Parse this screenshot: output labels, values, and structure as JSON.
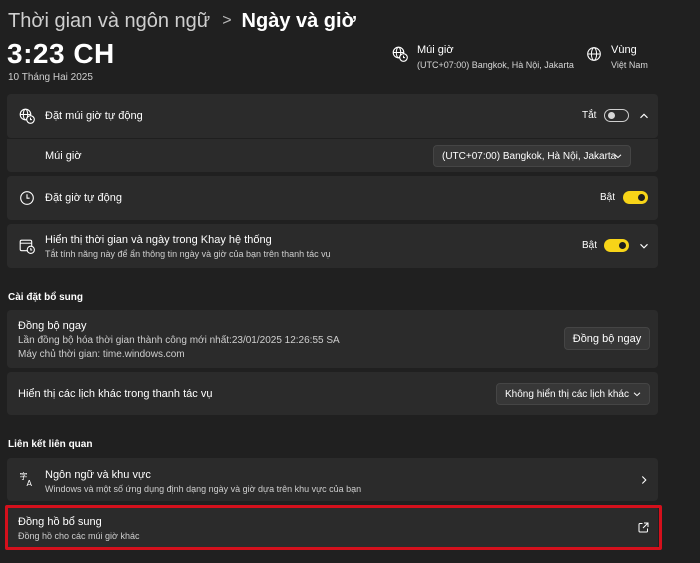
{
  "header": {
    "breadcrumb_parent": "Thời gian và ngôn ngữ",
    "breadcrumb_separator": ">",
    "breadcrumb_current": "Ngày và giờ"
  },
  "clock": {
    "time": "3:23 CH",
    "date": "10 Tháng Hai 2025"
  },
  "timezone_info": {
    "title": "Múi giờ",
    "value": "(UTC+07:00) Bangkok, Hà Nội, Jakarta",
    "icon": "globe-clock-icon"
  },
  "region_info": {
    "title": "Vùng",
    "value": "Việt Nam",
    "icon": "globe-icon"
  },
  "settings": {
    "auto_timezone": {
      "label": "Đặt múi giờ tự động",
      "state": "Tắt",
      "on": false,
      "icon": "timezone-icon"
    },
    "timezone_select": {
      "label": "Múi giờ",
      "value": "(UTC+07:00) Bangkok, Hà Nội, Jakarta"
    },
    "auto_time": {
      "label": "Đặt giờ tự động",
      "state": "Bật",
      "on": true,
      "icon": "clock-icon"
    },
    "show_tray": {
      "label": "Hiển thị thời gian và ngày trong Khay hệ thống",
      "description": "Tắt tính năng này để ẩn thông tin ngày và giờ của bạn trên thanh tác vụ",
      "state": "Bật",
      "on": true,
      "icon": "calendar-clock-icon"
    }
  },
  "additional": {
    "section_title": "Cài đặt bổ sung",
    "sync": {
      "title": "Đồng bộ ngay",
      "last_sync": "Lần đồng bộ hóa thời gian thành công mới nhất:23/01/2025 12:26:55 SA",
      "server": "Máy chủ thời gian: time.windows.com",
      "button": "Đồng bộ ngay"
    },
    "calendars": {
      "label": "Hiển thị các lịch khác trong thanh tác vụ",
      "value": "Không hiển thị các lịch khác"
    }
  },
  "related": {
    "section_title": "Liên kết liên quan",
    "language_region": {
      "title": "Ngôn ngữ và khu vực",
      "description": "Windows và một số ứng dụng định dạng ngày và giờ dựa trên khu vực của bạn",
      "icon": "language-icon"
    },
    "additional_clocks": {
      "title": "Đồng hồ bổ sung",
      "description": "Đồng hồ cho các múi giờ khác",
      "icon": "external-link-icon"
    }
  },
  "colors": {
    "background": "#202020",
    "card": "#2b2b2b",
    "accent": "#f7d418",
    "highlight": "#d4101c"
  }
}
